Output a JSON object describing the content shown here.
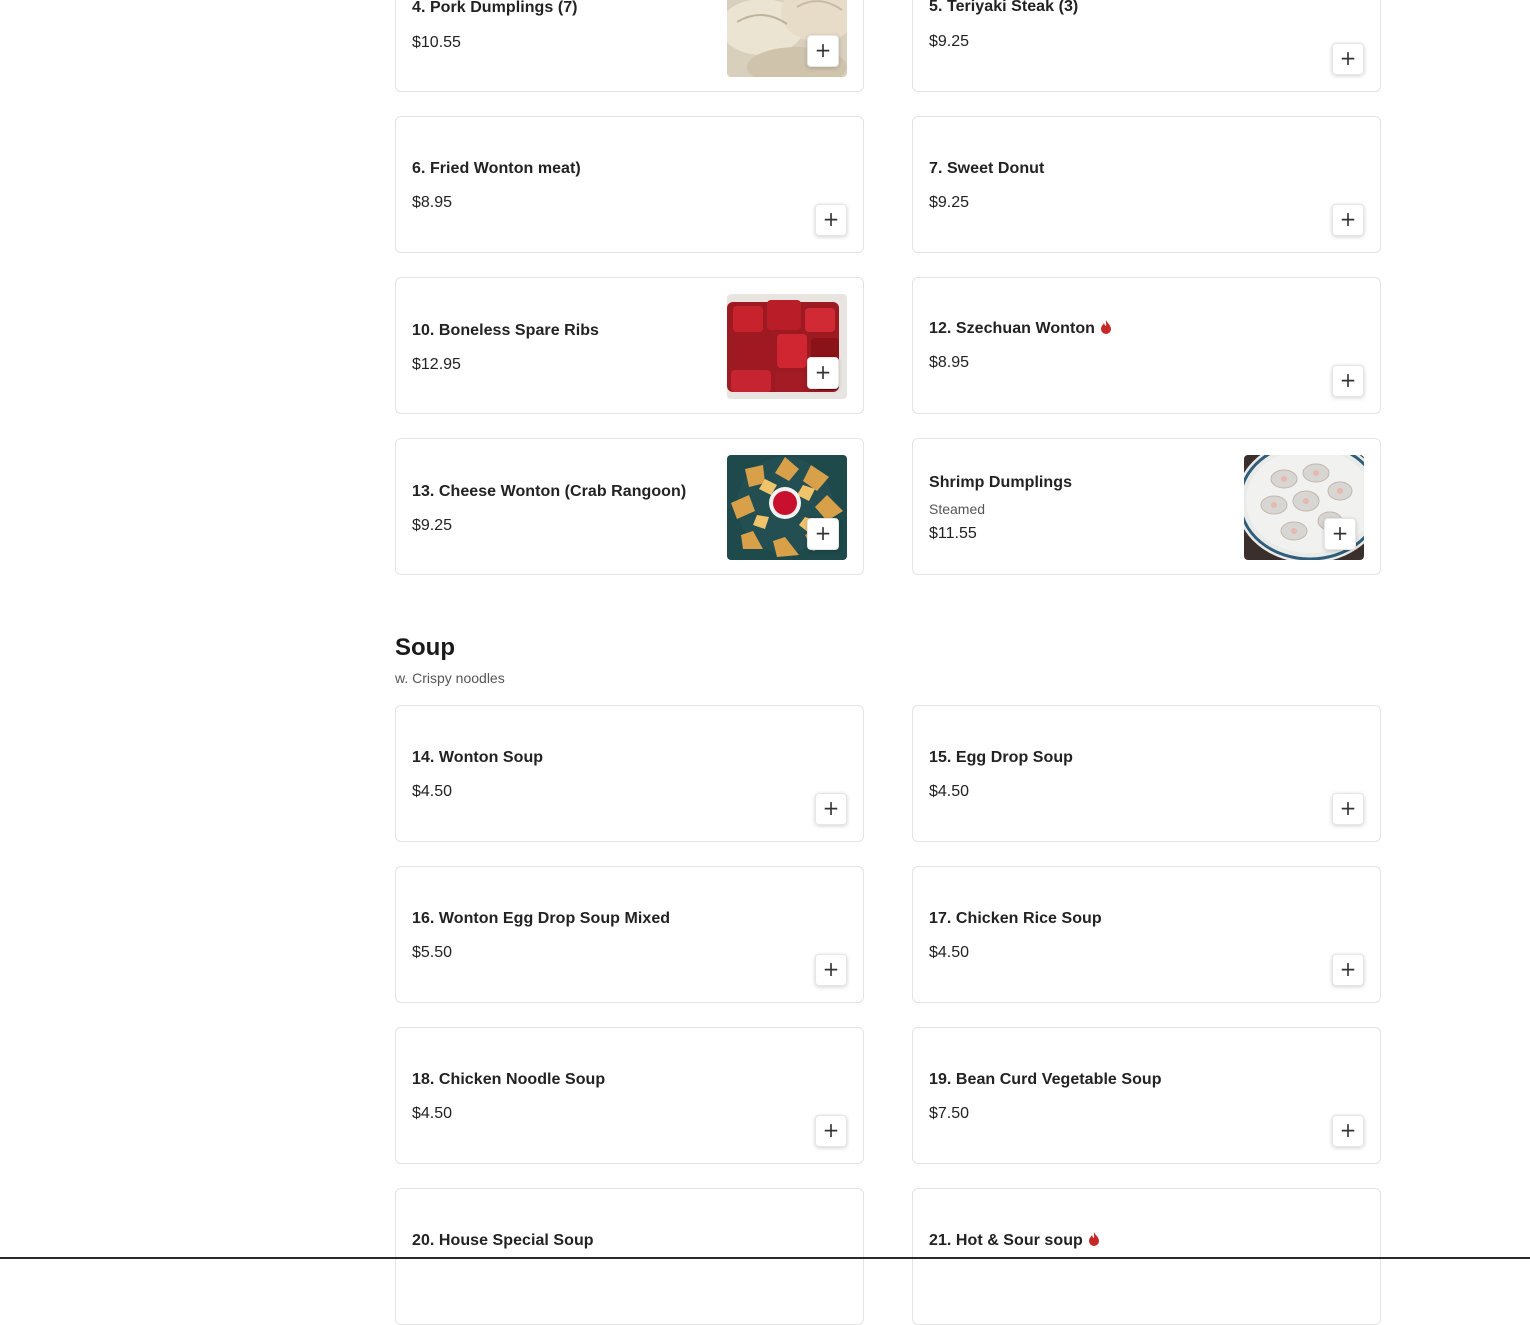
{
  "colors": {
    "spicy": "#c62828",
    "border": "#e3e3e3",
    "text": "#222222"
  },
  "icons": {
    "add": "plus-icon",
    "spicy": "flame-icon"
  },
  "add_label": "+",
  "top_items": [
    {
      "name": "4. Pork Dumplings (7)",
      "price": "$10.55"
    },
    {
      "name": "5. Teriyaki Steak (3)",
      "price": "$9.25"
    },
    {
      "name": "6. Fried Wonton   meat)",
      "price": "$8.95"
    },
    {
      "name": "7. Sweet Donut",
      "price": "$9.25"
    },
    {
      "name": "10. Boneless Spare Ribs",
      "price": "$12.95"
    },
    {
      "name": "12. Szechuan Wonton",
      "price": "$8.95",
      "spicy": true
    },
    {
      "name": "13. Cheese Wonton (Crab Rangoon)",
      "price": "$9.25"
    },
    {
      "name": "Shrimp Dumplings",
      "description": "Steamed",
      "price": "$11.55"
    }
  ],
  "soup_section": {
    "title": "Soup",
    "subtitle": "w. Crispy noodles",
    "items": [
      {
        "name": "14. Wonton Soup",
        "price": "$4.50"
      },
      {
        "name": "15. Egg Drop Soup",
        "price": "$4.50"
      },
      {
        "name": "16. Wonton Egg Drop Soup Mixed",
        "price": "$5.50"
      },
      {
        "name": "17. Chicken Rice Soup",
        "price": "$4.50"
      },
      {
        "name": "18. Chicken Noodle Soup",
        "price": "$4.50"
      },
      {
        "name": "19. Bean Curd Vegetable Soup",
        "price": "$7.50"
      },
      {
        "name": "20. House Special Soup"
      },
      {
        "name": "21. Hot & Sour soup",
        "spicy": true
      }
    ]
  }
}
